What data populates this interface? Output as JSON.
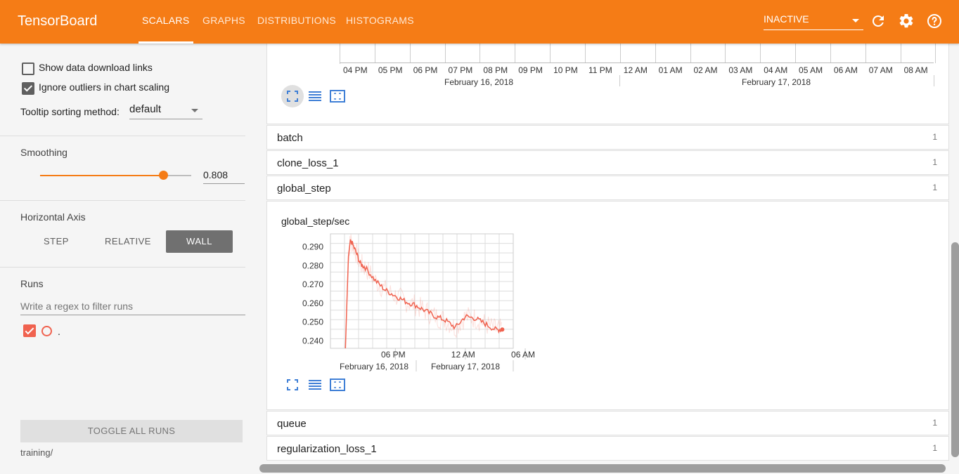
{
  "header": {
    "brand": "TensorBoard",
    "tabs": [
      {
        "label": "SCALARS",
        "active": true
      },
      {
        "label": "GRAPHS",
        "active": false
      },
      {
        "label": "DISTRIBUTIONS",
        "active": false
      },
      {
        "label": "HISTOGRAMS",
        "active": false
      }
    ],
    "run_select": "INACTIVE",
    "icons": [
      "refresh-icon",
      "gear-icon",
      "help-icon"
    ],
    "accent": "#f57c16"
  },
  "sidebar": {
    "show_download_links": {
      "label": "Show data download links",
      "checked": false
    },
    "ignore_outliers": {
      "label": "Ignore outliers in chart scaling",
      "checked": true
    },
    "tooltip_sorting": {
      "label": "Tooltip sorting method:",
      "value": "default"
    },
    "smoothing": {
      "title": "Smoothing",
      "value": "0.808",
      "fraction": 0.808
    },
    "horizontal_axis": {
      "title": "Horizontal Axis",
      "options": [
        "STEP",
        "RELATIVE",
        "WALL"
      ],
      "selected": "WALL"
    },
    "runs": {
      "title": "Runs",
      "filter_placeholder": "Write a regex to filter runs",
      "items": [
        {
          "label": ".",
          "checked": true,
          "color": "#f0624f"
        }
      ],
      "toggle_label": "TOGGLE ALL RUNS",
      "log_dir": "training/"
    }
  },
  "top_chart": {
    "ticks": [
      "04 PM",
      "05 PM",
      "06 PM",
      "07 PM",
      "08 PM",
      "09 PM",
      "10 PM",
      "11 PM",
      "12 AM",
      "01 AM",
      "02 AM",
      "03 AM",
      "04 AM",
      "05 AM",
      "06 AM",
      "07 AM",
      "08 AM"
    ],
    "dates": [
      "February 16, 2018",
      "February 17, 2018"
    ]
  },
  "categories": [
    {
      "name": "batch",
      "count": "1"
    },
    {
      "name": "clone_loss_1",
      "count": "1"
    },
    {
      "name": "global_step",
      "count": "1"
    },
    {
      "name": "queue",
      "count": "1"
    },
    {
      "name": "regularization_loss_1",
      "count": "1"
    }
  ],
  "chart_data": {
    "type": "line",
    "title": "global_step/sec",
    "x_ticks": [
      "06 PM",
      "12 AM",
      "06 AM"
    ],
    "x_dates": [
      "February 16, 2018",
      "February 17, 2018"
    ],
    "y_ticks": [
      "0.290",
      "0.280",
      "0.270",
      "0.260",
      "0.250",
      "0.240"
    ],
    "ylim": [
      0.236,
      0.297
    ],
    "x": [
      0,
      0.3,
      0.5,
      1,
      1.5,
      2,
      3,
      4,
      5,
      6,
      7,
      8,
      9,
      10,
      11,
      12,
      13,
      14,
      15,
      15.7
    ],
    "xlim": [
      -1.5,
      16.8
    ],
    "y": [
      0.236,
      0.285,
      0.294,
      0.288,
      0.281,
      0.279,
      0.272,
      0.267,
      0.264,
      0.261,
      0.259,
      0.256,
      0.253,
      0.251,
      0.247,
      0.253,
      0.252,
      0.249,
      0.246,
      0.246
    ],
    "series": [
      {
        "values": "smoothed",
        "color": "#f0624f"
      }
    ],
    "grid": true
  }
}
